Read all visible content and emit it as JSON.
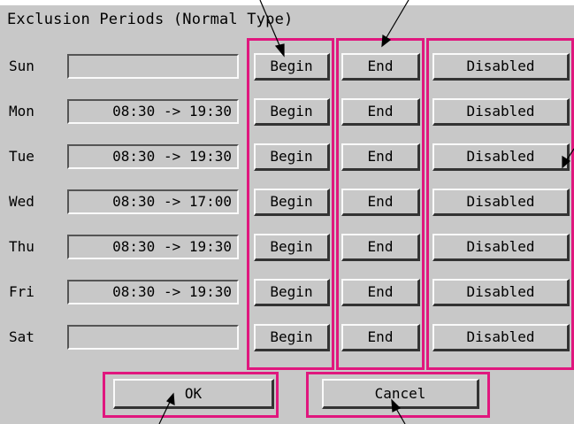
{
  "dialog": {
    "title": "Exclusion Periods (Normal Type)"
  },
  "rows": [
    {
      "day": "Sun",
      "period": "",
      "begin_label": "Begin",
      "end_label": "End",
      "disabled_label": "Disabled"
    },
    {
      "day": "Mon",
      "period": "08:30 -> 19:30",
      "begin_label": "Begin",
      "end_label": "End",
      "disabled_label": "Disabled"
    },
    {
      "day": "Tue",
      "period": "08:30 -> 19:30",
      "begin_label": "Begin",
      "end_label": "End",
      "disabled_label": "Disabled"
    },
    {
      "day": "Wed",
      "period": "08:30 -> 17:00",
      "begin_label": "Begin",
      "end_label": "End",
      "disabled_label": "Disabled"
    },
    {
      "day": "Thu",
      "period": "08:30 -> 19:30",
      "begin_label": "Begin",
      "end_label": "End",
      "disabled_label": "Disabled"
    },
    {
      "day": "Fri",
      "period": "08:30 -> 19:30",
      "begin_label": "Begin",
      "end_label": "End",
      "disabled_label": "Disabled"
    },
    {
      "day": "Sat",
      "period": "",
      "begin_label": "Begin",
      "end_label": "End",
      "disabled_label": "Disabled"
    }
  ],
  "footer": {
    "ok_label": "OK",
    "cancel_label": "Cancel"
  },
  "colors": {
    "panel_background": "#c8c8c8",
    "highlight": "#e0177e"
  }
}
